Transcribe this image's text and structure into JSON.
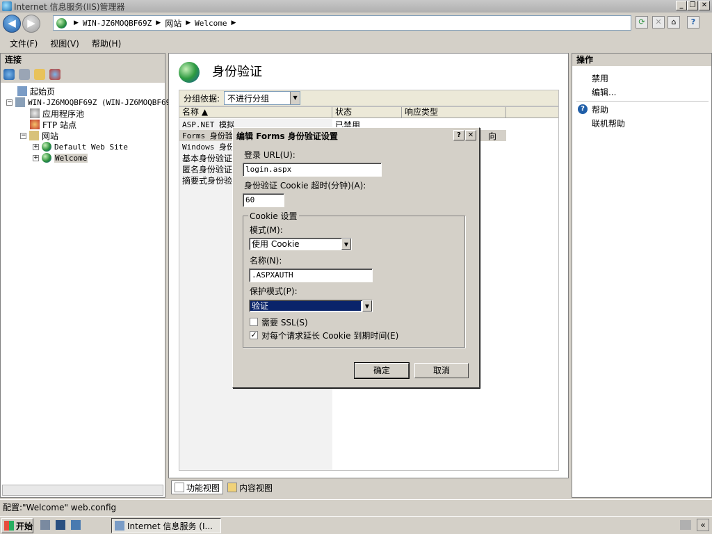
{
  "window": {
    "title": "Internet 信息服务(IIS)管理器",
    "btn_min": "_",
    "btn_restore": "❐",
    "btn_close": "✕"
  },
  "address": {
    "segments": [
      "WIN-JZ6MOQBF69Z",
      "网站",
      "Welcome"
    ],
    "sep": "▶"
  },
  "nav": {
    "back": "◀",
    "forward": "▶"
  },
  "toolbar_right": {
    "refresh": "⟳",
    "stop": "✕",
    "home": "⌂",
    "help": "?"
  },
  "menu": [
    "文件(F)",
    "视图(V)",
    "帮助(H)"
  ],
  "connections": {
    "header": "连接",
    "tree": {
      "start_page": "起始页",
      "server": "WIN-JZ6MOQBF69Z (WIN-JZ6MOQBF69Z",
      "app_pools": "应用程序池",
      "ftp": "FTP 站点",
      "sites": "网站",
      "default_site": "Default Web Site",
      "welcome": "Welcome"
    }
  },
  "center": {
    "title": "身份验证",
    "group_label": "分组依据:",
    "group_value": "不进行分组",
    "columns": [
      "名称 ▲",
      "状态",
      "响应类型"
    ],
    "rows": [
      {
        "name": "ASP.NET 模拟",
        "status": "已禁用",
        "type": ""
      },
      {
        "name": "Forms 身份验",
        "status": "",
        "type": "向"
      },
      {
        "name": "Windows 身份",
        "status": "",
        "type": ""
      },
      {
        "name": "基本身份验证",
        "status": "",
        "type": ""
      },
      {
        "name": "匿名身份验证",
        "status": "",
        "type": ""
      },
      {
        "name": "摘要式身份验",
        "status": "",
        "type": ""
      }
    ]
  },
  "bottom_tabs": {
    "feature": "功能视图",
    "content": "内容视图"
  },
  "actions": {
    "header": "操作",
    "disable": "禁用",
    "edit": "编辑...",
    "help": "帮助",
    "online_help": "联机帮助"
  },
  "status": {
    "text": "配置:\"Welcome\" web.config"
  },
  "taskbar": {
    "start": "开始",
    "app": "Internet 信息服务 (I..."
  },
  "dialog": {
    "title": "编辑 Forms 身份验证设置",
    "help_btn": "?",
    "close_btn": "✕",
    "login_url_label": "登录 URL(U):",
    "login_url_value": "login.aspx",
    "timeout_label": "身份验证 Cookie 超时(分钟)(A):",
    "timeout_value": "60",
    "cookie_group": "Cookie 设置",
    "mode_label": "模式(M):",
    "mode_value": "使用 Cookie",
    "name_label": "名称(N):",
    "name_value": ".ASPXAUTH",
    "protection_label": "保护模式(P):",
    "protection_value": "验证",
    "ssl_label": "需要 SSL(S)",
    "ssl_checked": false,
    "extend_label": "对每个请求延长 Cookie 到期时间(E)",
    "extend_checked": true,
    "ok": "确定",
    "cancel": "取消"
  },
  "colors": {
    "selection": "#0a246a",
    "accent": "#1f5ea8"
  }
}
